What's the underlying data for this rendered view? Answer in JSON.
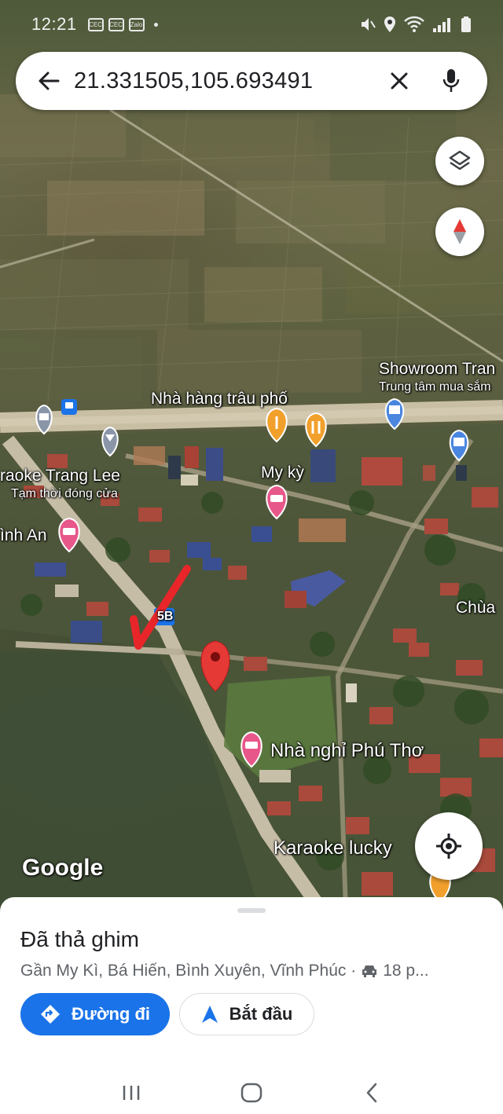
{
  "status_bar": {
    "time": "12:21",
    "notifications": [
      "CEC",
      "CEC",
      "Zalo"
    ]
  },
  "search": {
    "value": "21.331505,105.693491"
  },
  "map": {
    "labels": [
      {
        "key": "showroom",
        "text": "Showroom Tran"
      },
      {
        "key": "trung_tam",
        "text": "Trung tâm mua sắm"
      },
      {
        "key": "nha_hang",
        "text": "Nhà hàng trâu phố"
      },
      {
        "key": "karaoke_trang",
        "text": "raoke Trang Lee"
      },
      {
        "key": "tam_thoi",
        "text": "Tạm thời đóng cửa"
      },
      {
        "key": "my_ky",
        "text": "My kỳ"
      },
      {
        "key": "inh_an",
        "text": "ình An"
      },
      {
        "key": "chua",
        "text": "Chùa"
      },
      {
        "key": "nha_nghi",
        "text": "Nhà nghỉ Phú Thơ"
      },
      {
        "key": "karaoke_lucky",
        "text": "Karaoke lucky"
      },
      {
        "key": "road_shield",
        "text": "5B"
      }
    ],
    "google_logo": "Google",
    "pin_color": "#e53935",
    "annotation_color": "#e8262a"
  },
  "place": {
    "title": "Đã thả ghim",
    "address": "Gần My Kì, Bá Hiến, Bình Xuyên, Vĩnh Phúc ·",
    "drive_time": "18 p..."
  },
  "actions": {
    "directions_label": "Đường đi",
    "start_label": "Bắt đầu"
  },
  "colors": {
    "accent": "#1a73e8"
  }
}
